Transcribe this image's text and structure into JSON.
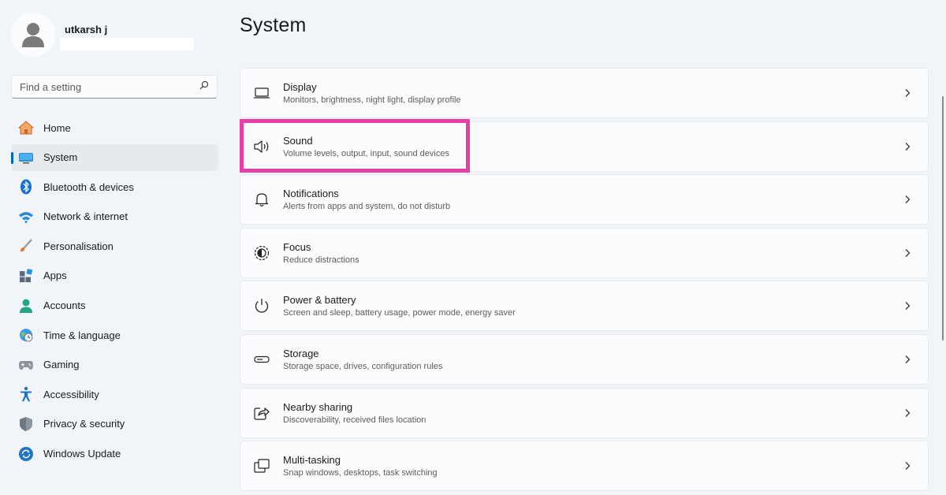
{
  "profile": {
    "name": "utkarsh j"
  },
  "search": {
    "placeholder": "Find a setting"
  },
  "sidebar": {
    "items": [
      {
        "label": "Home",
        "icon": "home-icon"
      },
      {
        "label": "System",
        "icon": "monitor-icon",
        "active": true
      },
      {
        "label": "Bluetooth & devices",
        "icon": "bluetooth-icon"
      },
      {
        "label": "Network & internet",
        "icon": "wifi-icon"
      },
      {
        "label": "Personalisation",
        "icon": "brush-icon"
      },
      {
        "label": "Apps",
        "icon": "apps-icon"
      },
      {
        "label": "Accounts",
        "icon": "person-icon"
      },
      {
        "label": "Time & language",
        "icon": "clock-globe-icon"
      },
      {
        "label": "Gaming",
        "icon": "gamepad-icon"
      },
      {
        "label": "Accessibility",
        "icon": "accessibility-icon"
      },
      {
        "label": "Privacy & security",
        "icon": "shield-icon"
      },
      {
        "label": "Windows Update",
        "icon": "update-icon"
      }
    ]
  },
  "main": {
    "title": "System",
    "cards": [
      {
        "title": "Display",
        "subtitle": "Monitors, brightness, night light, display profile",
        "icon": "display-icon"
      },
      {
        "title": "Sound",
        "subtitle": "Volume levels, output, input, sound devices",
        "icon": "speaker-icon"
      },
      {
        "title": "Notifications",
        "subtitle": "Alerts from apps and system, do not disturb",
        "icon": "bell-icon"
      },
      {
        "title": "Focus",
        "subtitle": "Reduce distractions",
        "icon": "focus-icon"
      },
      {
        "title": "Power & battery",
        "subtitle": "Screen and sleep, battery usage, power mode, energy saver",
        "icon": "power-icon"
      },
      {
        "title": "Storage",
        "subtitle": "Storage space, drives, configuration rules",
        "icon": "storage-icon"
      },
      {
        "title": "Nearby sharing",
        "subtitle": "Discoverability, received files location",
        "icon": "share-icon"
      },
      {
        "title": "Multi-tasking",
        "subtitle": "Snap windows, desktops, task switching",
        "icon": "multitask-icon"
      }
    ]
  },
  "colors": {
    "accent": "#0067c0",
    "highlight": "#e83ea8",
    "background": "#f1f4f9"
  }
}
